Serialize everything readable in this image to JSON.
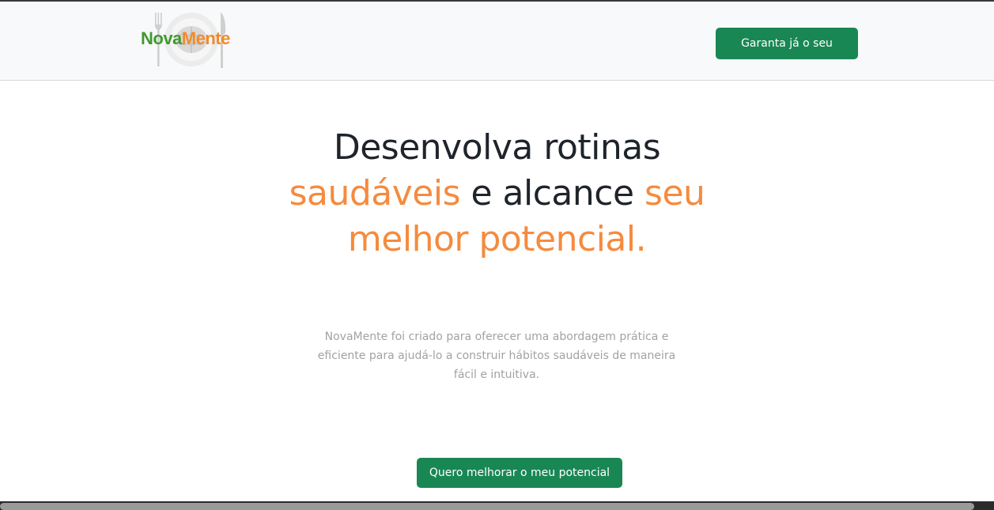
{
  "navbar": {
    "logo_part1": "Nova",
    "logo_part2": "Mente",
    "cta_label": "Garanta já o seu"
  },
  "hero": {
    "line1": "Desenvolva rotinas",
    "line2_accent1": "saudáveis",
    "line2_middle": " e alcance ",
    "line2_accent2": "seu",
    "line3_accent": "melhor potencial."
  },
  "description": "NovaMente foi criado para oferecer uma abordagem prática e eficiente para ajudá-lo a construir hábitos saudáveis de maneira fácil e intuitiva.",
  "cta": {
    "label": "Quero melhorar o meu potencial"
  },
  "colors": {
    "primary_green": "#198754",
    "accent_orange": "#f58b3e",
    "logo_green": "#3f9a2e",
    "logo_orange": "#f28a2a"
  },
  "icons": [
    "fork-icon",
    "plate-brain-icon",
    "knife-icon"
  ]
}
